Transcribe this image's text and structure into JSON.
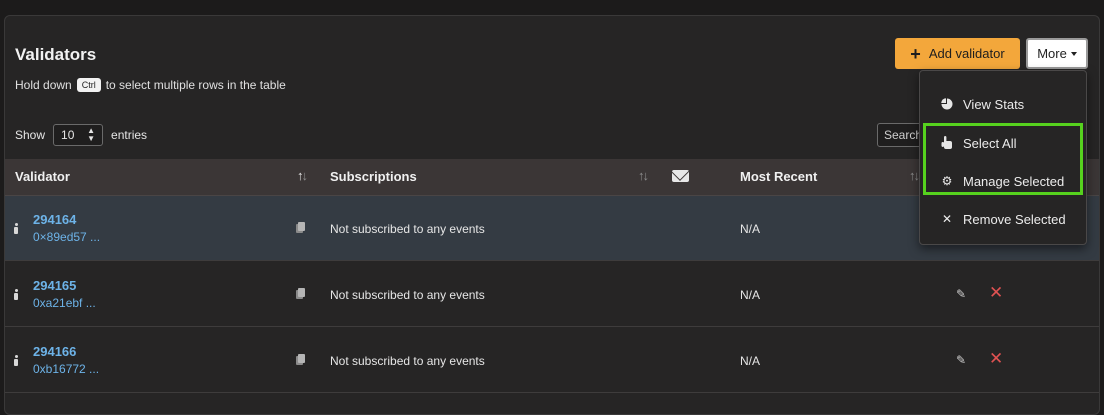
{
  "header": {
    "title": "Validators",
    "hint_before": "Hold down",
    "hint_key": "Ctrl",
    "hint_after": "to select multiple rows in the table",
    "add_button_label": "Add validator",
    "more_button_label": "More"
  },
  "table_controls": {
    "show_label": "Show",
    "entries_value": "10",
    "entries_label": "entries",
    "search_label": "Search"
  },
  "table": {
    "columns": [
      "Validator",
      "Subscriptions",
      "Most Recent"
    ],
    "rows": [
      {
        "index": "294164",
        "address": "0×89ed57 ...",
        "subscriptions": "Not subscribed to any events",
        "most_recent": "N/A"
      },
      {
        "index": "294165",
        "address": "0xa21ebf ...",
        "subscriptions": "Not subscribed to any events",
        "most_recent": "N/A"
      },
      {
        "index": "294166",
        "address": "0xb16772 ...",
        "subscriptions": "Not subscribed to any events",
        "most_recent": "N/A"
      }
    ]
  },
  "more_menu": {
    "items": [
      {
        "label": "View Stats",
        "icon": "pie-chart-icon"
      },
      {
        "label": "Select All",
        "icon": "hand-pointer-icon"
      },
      {
        "label": "Manage Selected",
        "icon": "gear-icon"
      },
      {
        "label": "Remove Selected",
        "icon": "close-icon"
      }
    ]
  },
  "colors": {
    "accent": "#f3a73b",
    "link": "#6db3e8",
    "danger": "#e05252",
    "highlight": "#56d21e"
  }
}
